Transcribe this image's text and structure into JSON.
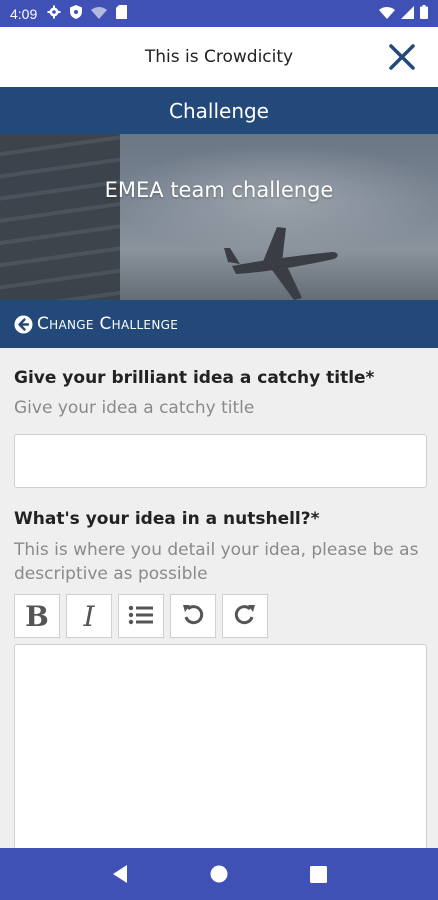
{
  "status_bar": {
    "time": "4:09"
  },
  "app_bar": {
    "title": "This is Crowdicity"
  },
  "section": {
    "title": "Challenge"
  },
  "banner": {
    "title": "EMEA team challenge"
  },
  "change_challenge": {
    "label": "Change Challenge"
  },
  "form": {
    "title_label": "Give your brilliant idea a catchy title*",
    "title_hint": "Give your idea a catchy title",
    "title_value": "",
    "nutshell_label": "What's your idea in a nutshell?*",
    "nutshell_hint": "This is where you detail your idea, please be as descriptive as possible",
    "nutshell_value": ""
  },
  "toolbar": {
    "bold_label": "B",
    "italic_label": "I"
  },
  "icons": [
    "settings-icon",
    "shield-icon",
    "wifi-icon",
    "sim-icon",
    "signal-icon",
    "battery-icon",
    "close-icon",
    "arrow-left-circle-icon",
    "list-icon",
    "undo-icon",
    "redo-icon",
    "back-icon",
    "home-icon",
    "recents-icon"
  ],
  "colors": {
    "status_bar": "#3f51b5",
    "header": "#23497a",
    "close": "#23497a",
    "nav_bar": "#3f51b5"
  }
}
